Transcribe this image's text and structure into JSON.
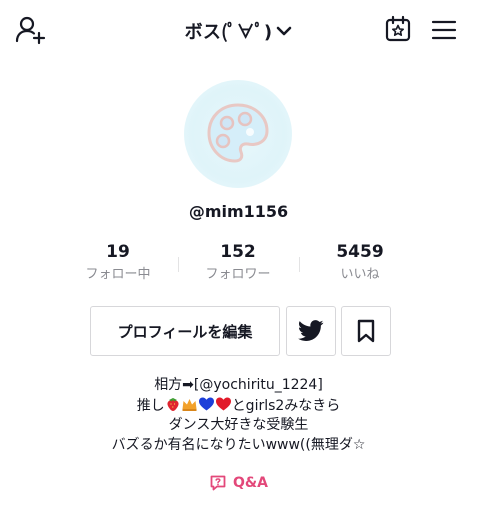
{
  "header": {
    "title": "ボス(ﾟ∀ﾟ)"
  },
  "profile": {
    "username": "@mim1156"
  },
  "stats": [
    {
      "value": "19",
      "label": "フォロー中"
    },
    {
      "value": "152",
      "label": "フォロワー"
    },
    {
      "value": "5459",
      "label": "いいね"
    }
  ],
  "actions": {
    "edit_label": "プロフィールを編集"
  },
  "bio": {
    "line1": "相方➡[@yochiritu_1224]",
    "line2_prefix": "推し",
    "line2_suffix": "とgirls2みなきら",
    "line3": "ダンス大好きな受験生",
    "line4": "バズるか有名になりたいwww((無理ダ☆"
  },
  "qa": {
    "label": "Q&A"
  },
  "colors": {
    "accent": "#e3487a",
    "text": "#161823",
    "muted": "#8a8b91"
  },
  "icons": [
    "add-user-icon",
    "chevron-down-icon",
    "calendar-star-icon",
    "menu-icon",
    "palette-icon",
    "twitter-icon",
    "bookmark-icon",
    "strawberry-icon",
    "crown-icon",
    "blue-heart-icon",
    "red-heart-icon",
    "qa-icon"
  ]
}
